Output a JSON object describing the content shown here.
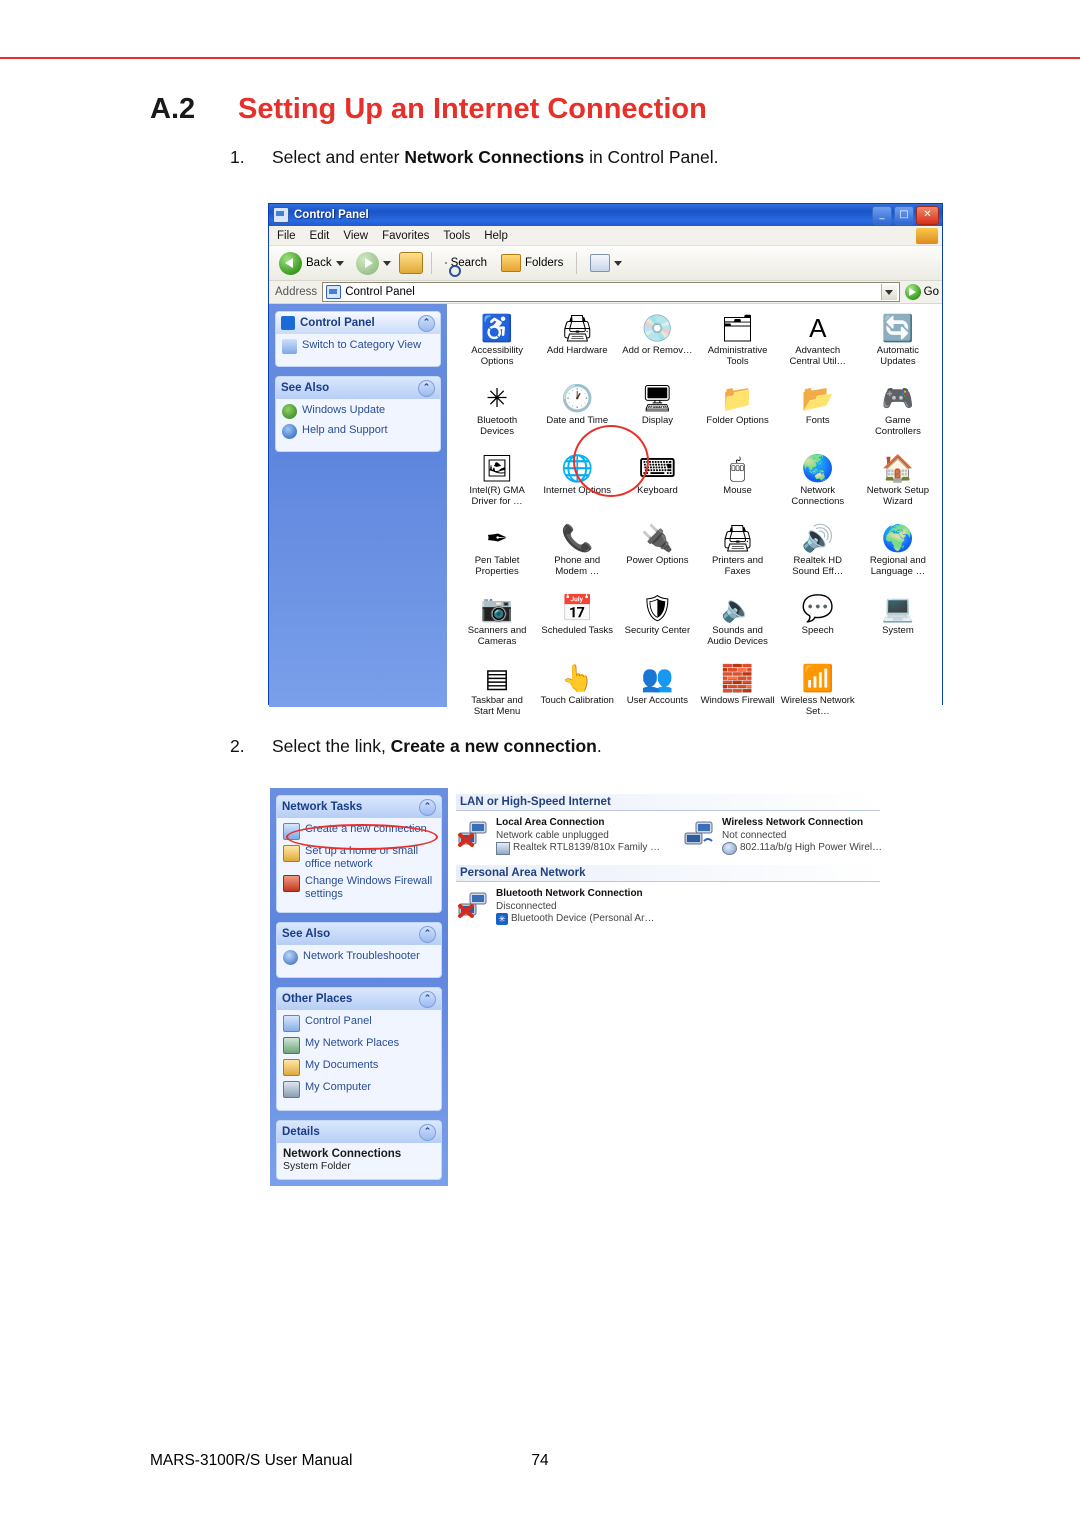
{
  "heading": {
    "number": "A.2",
    "title": "Setting Up an Internet Connection"
  },
  "steps": [
    {
      "index": "1.",
      "text_pre": "Select and enter ",
      "text_bold": "Network Connections",
      "text_post": " in Control Panel."
    },
    {
      "index": "2.",
      "text_pre": "Select the link, ",
      "text_bold": "Create a new connection",
      "text_post": "."
    }
  ],
  "control_panel": {
    "title": "Control Panel",
    "window_buttons": {
      "minimize": "_",
      "maximize": "□",
      "close": "✕"
    },
    "menu": [
      "File",
      "Edit",
      "View",
      "Favorites",
      "Tools",
      "Help"
    ],
    "toolbar": {
      "back": "Back",
      "search": "Search",
      "folders": "Folders"
    },
    "address": {
      "label": "Address",
      "value": "Control Panel",
      "go": "Go"
    },
    "sidebar": {
      "header_item": "Control Panel",
      "switch_view": "Switch to Category View",
      "see_also_title": "See Also",
      "see_also_items": [
        "Windows Update",
        "Help and Support"
      ]
    },
    "icons": [
      {
        "label": "Accessibility Options",
        "glyph": "♿"
      },
      {
        "label": "Add Hardware",
        "glyph": "🖨"
      },
      {
        "label": "Add or Remov…",
        "glyph": "💿"
      },
      {
        "label": "Administrative Tools",
        "glyph": "🗂"
      },
      {
        "label": "Advantech Central Util…",
        "glyph": "A"
      },
      {
        "label": "Automatic Updates",
        "glyph": "🔄"
      },
      {
        "label": "Bluetooth Devices",
        "glyph": "✳"
      },
      {
        "label": "Date and Time",
        "glyph": "🕐"
      },
      {
        "label": "Display",
        "glyph": "🖥"
      },
      {
        "label": "Folder Options",
        "glyph": "📁"
      },
      {
        "label": "Fonts",
        "glyph": "📂"
      },
      {
        "label": "Game Controllers",
        "glyph": "🎮"
      },
      {
        "label": "Intel(R) GMA Driver for …",
        "glyph": "🖼"
      },
      {
        "label": "Internet Options",
        "glyph": "🌐"
      },
      {
        "label": "Keyboard",
        "glyph": "⌨"
      },
      {
        "label": "Mouse",
        "glyph": "🖱"
      },
      {
        "label": "Network Connections",
        "glyph": "🌏"
      },
      {
        "label": "Network Setup Wizard",
        "glyph": "🏠"
      },
      {
        "label": "Pen Tablet Properties",
        "glyph": "✒"
      },
      {
        "label": "Phone and Modem …",
        "glyph": "📞"
      },
      {
        "label": "Power Options",
        "glyph": "🔌"
      },
      {
        "label": "Printers and Faxes",
        "glyph": "🖨"
      },
      {
        "label": "Realtek HD Sound Eff…",
        "glyph": "🔊"
      },
      {
        "label": "Regional and Language …",
        "glyph": "🌍"
      },
      {
        "label": "Scanners and Cameras",
        "glyph": "📷"
      },
      {
        "label": "Scheduled Tasks",
        "glyph": "📅"
      },
      {
        "label": "Security Center",
        "glyph": "🛡"
      },
      {
        "label": "Sounds and Audio Devices",
        "glyph": "🔈"
      },
      {
        "label": "Speech",
        "glyph": "💬"
      },
      {
        "label": "System",
        "glyph": "💻"
      },
      {
        "label": "Taskbar and Start Menu",
        "glyph": "▤"
      },
      {
        "label": "Touch Calibration",
        "glyph": "👆"
      },
      {
        "label": "User Accounts",
        "glyph": "👥"
      },
      {
        "label": "Windows Firewall",
        "glyph": "🧱"
      },
      {
        "label": "Wireless Network Set…",
        "glyph": "📶"
      }
    ]
  },
  "network_connections": {
    "sidebar": {
      "tasks_title": "Network Tasks",
      "tasks": [
        "Create a new connection",
        "Set up a home or small office network",
        "Change Windows Firewall settings"
      ],
      "see_also_title": "See Also",
      "see_also": [
        "Network Troubleshooter"
      ],
      "other_places_title": "Other Places",
      "other_places": [
        "Control Panel",
        "My Network Places",
        "My Documents",
        "My Computer"
      ],
      "details_title": "Details",
      "details_name": "Network Connections",
      "details_type": "System Folder"
    },
    "groups": [
      {
        "title": "LAN or High-Speed Internet",
        "connections": [
          {
            "name": "Local Area Connection",
            "status": "Network cable unplugged",
            "device": "Realtek RTL8139/810x Family …"
          },
          {
            "name": "Wireless Network Connection",
            "status": "Not connected",
            "device": "802.11a/b/g High Power Wirel…"
          }
        ]
      },
      {
        "title": "Personal Area Network",
        "connections": [
          {
            "name": "Bluetooth Network Connection",
            "status": "Disconnected",
            "device": "Bluetooth Device (Personal Ar…"
          }
        ]
      }
    ]
  },
  "footer": {
    "left": "MARS-3100R/S User Manual",
    "page": "74"
  }
}
